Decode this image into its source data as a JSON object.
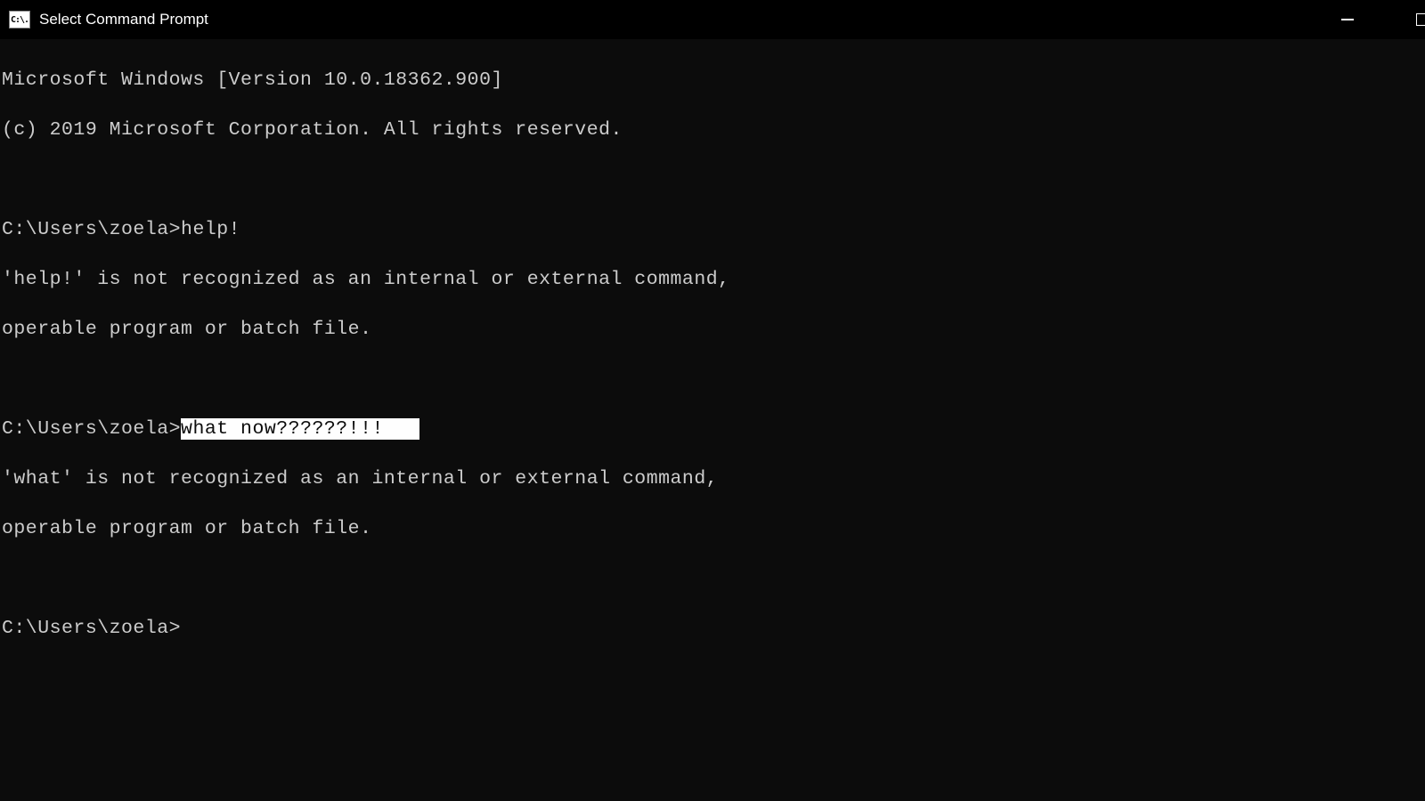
{
  "titlebar": {
    "icon_text": "C:\\.",
    "title": "Select Command Prompt"
  },
  "terminal": {
    "line1": "Microsoft Windows [Version 10.0.18362.900]",
    "line2": "(c) 2019 Microsoft Corporation. All rights reserved.",
    "blank1": "",
    "prompt1": "C:\\Users\\zoela>",
    "cmd1": "help!",
    "err1a": "'help!' is not recognized as an internal or external command,",
    "err1b": "operable program or batch file.",
    "blank2": "",
    "prompt2": "C:\\Users\\zoela>",
    "cmd2_selected": "what now??????!!!",
    "cmd2_pad": "   ",
    "err2a": "'what' is not recognized as an internal or external command,",
    "err2b": "operable program or batch file.",
    "blank3": "",
    "prompt3": "C:\\Users\\zoela>"
  }
}
